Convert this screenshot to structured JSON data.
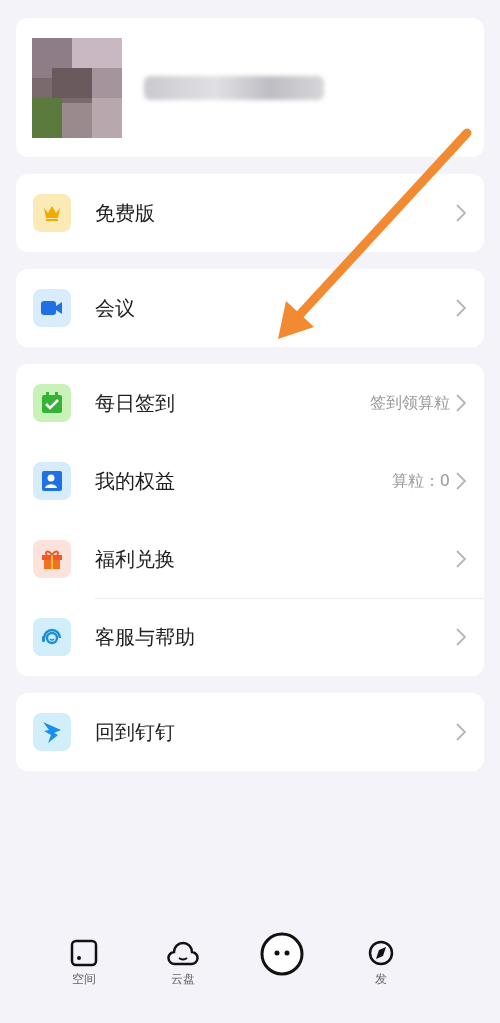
{
  "profile": {
    "name": {
      "kind": "redacted"
    }
  },
  "groups": [
    {
      "items": [
        {
          "kind": "crown",
          "label": "免费版",
          "divider_above": false
        }
      ]
    },
    {
      "items": [
        {
          "kind": "video",
          "label": "会议",
          "divider_above": false
        }
      ]
    },
    {
      "items": [
        {
          "kind": "calendar",
          "label": "每日签到",
          "value": "签到领算粒",
          "divider_above": false
        },
        {
          "kind": "contact",
          "label": "我的权益",
          "value": "算粒：0",
          "divider_above": false
        },
        {
          "kind": "gift",
          "label": "福利兑换",
          "divider_above": false
        },
        {
          "kind": "headset",
          "label": "客服与帮助",
          "divider_above": true
        }
      ]
    },
    {
      "items": [
        {
          "kind": "wing",
          "label": "回到钉钉",
          "divider_above": false
        }
      ]
    }
  ],
  "annotation_arrow": true,
  "tab_bar": [
    {
      "kind": "square",
      "label": "空间"
    },
    {
      "kind": "cloud",
      "label": "云盘"
    },
    {
      "kind": "face"
    },
    {
      "kind": "compass",
      "label": "发"
    }
  ]
}
